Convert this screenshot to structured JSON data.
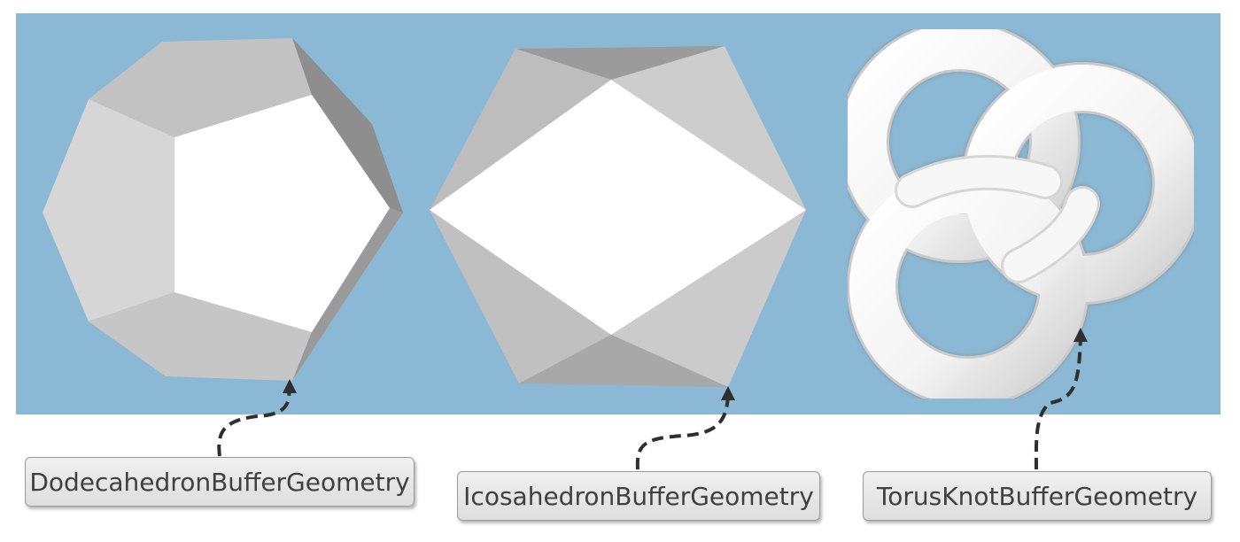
{
  "colors": {
    "viewport_background": "#8bb8d4",
    "page_background": "#ffffff",
    "arrow": "#2f2f2f"
  },
  "geometries": [
    {
      "id": "dodecahedron",
      "label": "DodecahedronBufferGeometry"
    },
    {
      "id": "icosahedron",
      "label": "IcosahedronBufferGeometry"
    },
    {
      "id": "torusknot",
      "label": "TorusKnotBufferGeometry"
    }
  ]
}
